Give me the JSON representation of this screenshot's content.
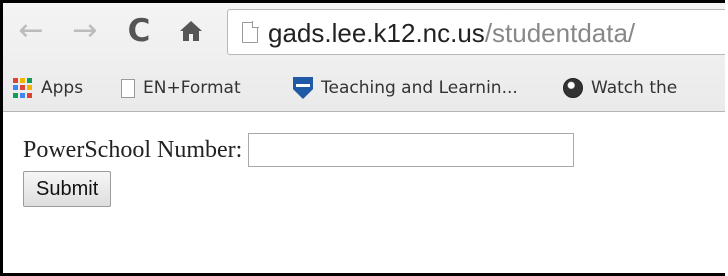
{
  "browser": {
    "nav": {
      "back_glyph": "←",
      "forward_glyph": "→",
      "reload_glyph": "C",
      "home_glyph": "🏠"
    },
    "address": {
      "domain": "gads.lee.k12.nc.us",
      "path": "/studentdata/"
    },
    "bookmarks": [
      {
        "label": "Apps",
        "icon": "apps-grid-icon"
      },
      {
        "label": "EN+Format",
        "icon": "page-icon"
      },
      {
        "label": "Teaching and Learnin...",
        "icon": "shield-icon"
      },
      {
        "label": "Watch the",
        "icon": "globe-icon"
      }
    ],
    "apps_icon_colors": [
      "#db4437",
      "#f4b400",
      "#0f9d58",
      "#4285f4",
      "#db4437",
      "#f4b400",
      "#0f9d58",
      "#4285f4",
      "#db4437"
    ]
  },
  "form": {
    "label": "PowerSchool Number:",
    "input_value": "",
    "submit_label": "Submit"
  }
}
